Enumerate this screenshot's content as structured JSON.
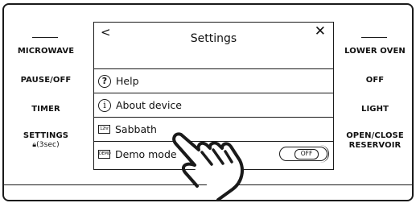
{
  "left_buttons": {
    "microwave": "MICROWAVE",
    "pause_off": "PAUSE/OFF",
    "timer": "TIMER",
    "settings": "SETTINGS",
    "settings_sub": "@(3sec)"
  },
  "right_buttons": {
    "lower_oven": "LOWER OVEN",
    "off": "OFF",
    "light": "LIGHT",
    "open_close_line1": "OPEN/CLOSE",
    "open_close_line2": "RESERVOIR"
  },
  "screen": {
    "title": "Settings",
    "back_glyph": "<",
    "close_glyph": "✕",
    "items": [
      {
        "label": "Help",
        "icon": "question-icon",
        "glyph": "?"
      },
      {
        "label": "About device",
        "icon": "info-icon",
        "glyph": "i"
      },
      {
        "label": "Sabbath",
        "icon": "12hr-icon",
        "glyph": "12hr"
      },
      {
        "label": "Demo mode",
        "icon": "demo-icon",
        "glyph": "DEMO"
      }
    ],
    "demo_toggle": "OFF"
  }
}
